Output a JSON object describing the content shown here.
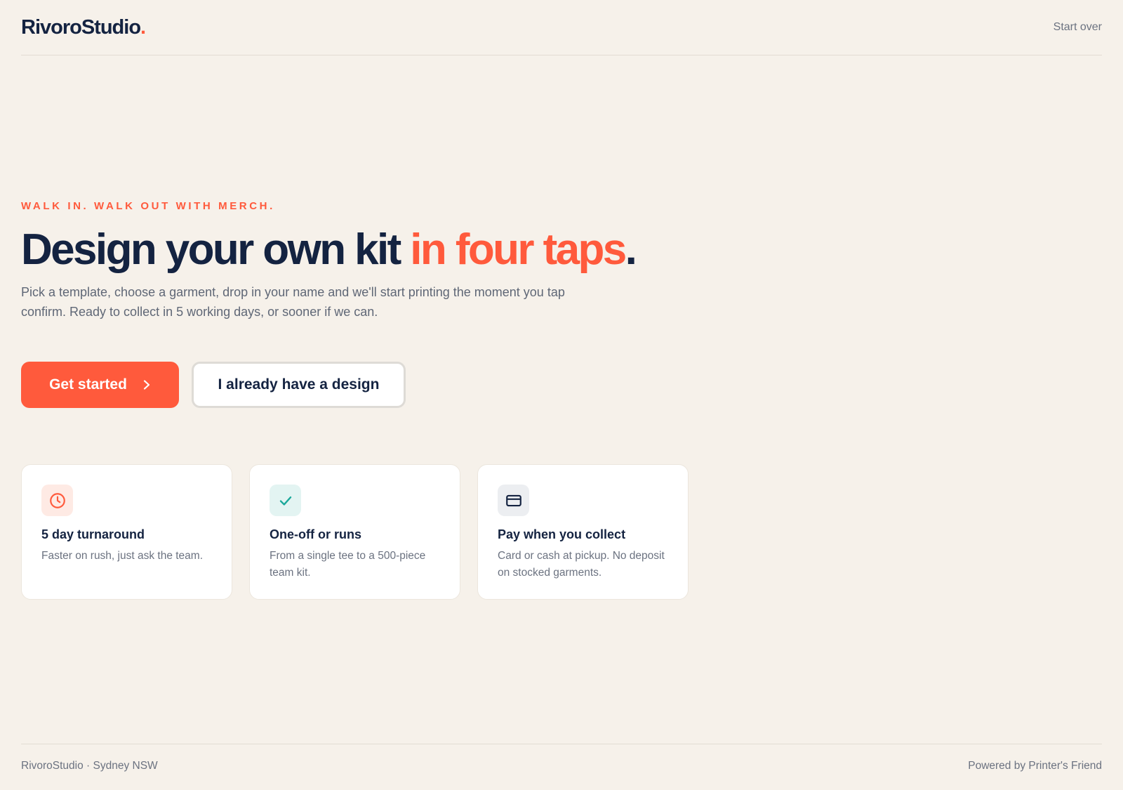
{
  "header": {
    "brand": "RivoroStudio",
    "brand_dot": ".",
    "start_over": "Start over"
  },
  "hero": {
    "eyebrow": "WALK IN. WALK OUT WITH MERCH.",
    "headline_main": "Design your own kit ",
    "headline_accent": "in four taps",
    "headline_end": ".",
    "lede": "Pick a template, choose a garment, drop in your name and we'll start printing the moment you tap confirm. Ready to collect in 5 working days, or sooner if we can."
  },
  "buttons": {
    "primary": "Get started",
    "secondary": "I already have a design"
  },
  "features": [
    {
      "icon": "clock-icon",
      "title": "5 day turnaround",
      "desc": "Faster on rush, just ask the team."
    },
    {
      "icon": "check-icon",
      "title": "One-off or runs",
      "desc": "From a single tee to a 500-piece team kit."
    },
    {
      "icon": "credit-card-icon",
      "title": "Pay when you collect",
      "desc": "Card or cash at pickup. No deposit on stocked garments."
    }
  ],
  "footer": {
    "left": "RivoroStudio · Sydney NSW",
    "right": "Powered by Printer's Friend"
  },
  "colors": {
    "background": "#f6f1ea",
    "accent": "#ff5a3c",
    "navy": "#142341",
    "teal": "#1aa89a"
  }
}
